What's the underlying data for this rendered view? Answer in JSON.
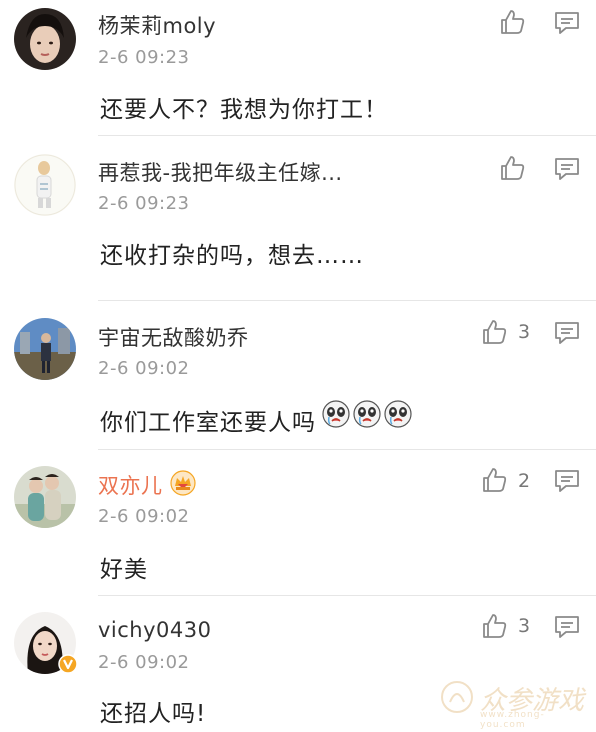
{
  "comments": [
    {
      "username": "杨茉莉moly",
      "time": "2-6 09:23",
      "text": "还要人不？我想为你打工！",
      "likes": ""
    },
    {
      "username": "再惹我-我把年级主任嫁...",
      "time": "2-6 09:23",
      "text": "还收打杂的吗，想去……",
      "likes": ""
    },
    {
      "username": "宇宙无敌酸奶乔",
      "time": "2-6 09:02",
      "text": "你们工作室还要人吗",
      "likes": "3"
    },
    {
      "username": "双亦儿",
      "time": "2-6 09:02",
      "text": "好美",
      "likes": "2"
    },
    {
      "username": "vichy0430",
      "time": "2-6 09:02",
      "text": "还招人吗!",
      "likes": "3"
    }
  ],
  "watermark": {
    "text": "众参游戏",
    "url": "www.zhong-you.com"
  },
  "icons": {
    "like": "thumbs-up-icon",
    "reply": "comment-bubble-icon",
    "emoji": "panda-cry-emoji-icon",
    "vip": "vip-crown-badge-icon",
    "verified": "verified-v-badge-icon"
  },
  "colors": {
    "username_vip": "#eb7350",
    "verified_badge": "#f5a623"
  }
}
